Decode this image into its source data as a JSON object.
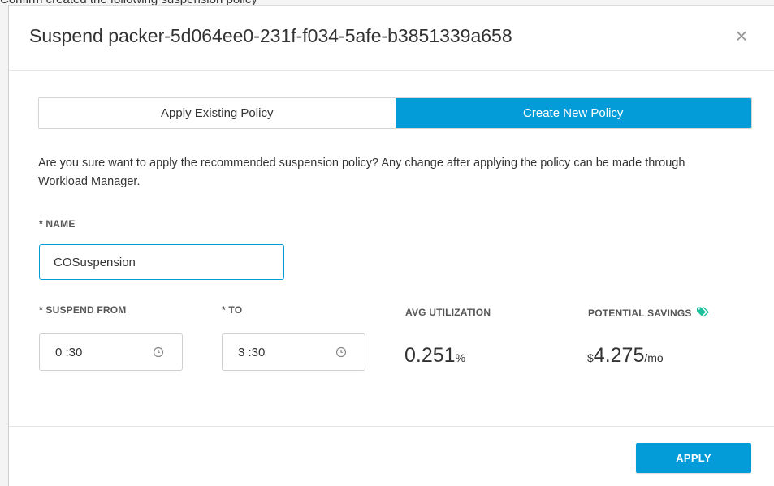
{
  "background": {
    "caption": "Confirm created the following suspension policy"
  },
  "modal": {
    "title": "Suspend packer-5d064ee0-231f-f034-5afe-b3851339a658",
    "close_label": "×"
  },
  "tabs": [
    {
      "label": "Apply Existing Policy",
      "active": false
    },
    {
      "label": "Create New Policy",
      "active": true
    }
  ],
  "description": "Are you sure want to apply the recommended suspension policy? Any change after applying the policy can be made through Workload Manager.",
  "name_field": {
    "label": "* NAME",
    "value": "COSuspension"
  },
  "suspend_from": {
    "label": "* SUSPEND FROM",
    "value": "0 :30"
  },
  "suspend_to": {
    "label": "* TO",
    "value": "3 :30"
  },
  "avg_utilization": {
    "label": "AVG UTILIZATION",
    "value": "0.251",
    "unit": "%"
  },
  "potential_savings": {
    "label": "POTENTIAL SAVINGS",
    "currency": "$",
    "value": "4.275",
    "unit": "/mo",
    "icon": "tags-icon"
  },
  "apply_button": {
    "label": "APPLY"
  },
  "colors": {
    "accent": "#049cd8",
    "savings_icon": "#20c09c"
  }
}
